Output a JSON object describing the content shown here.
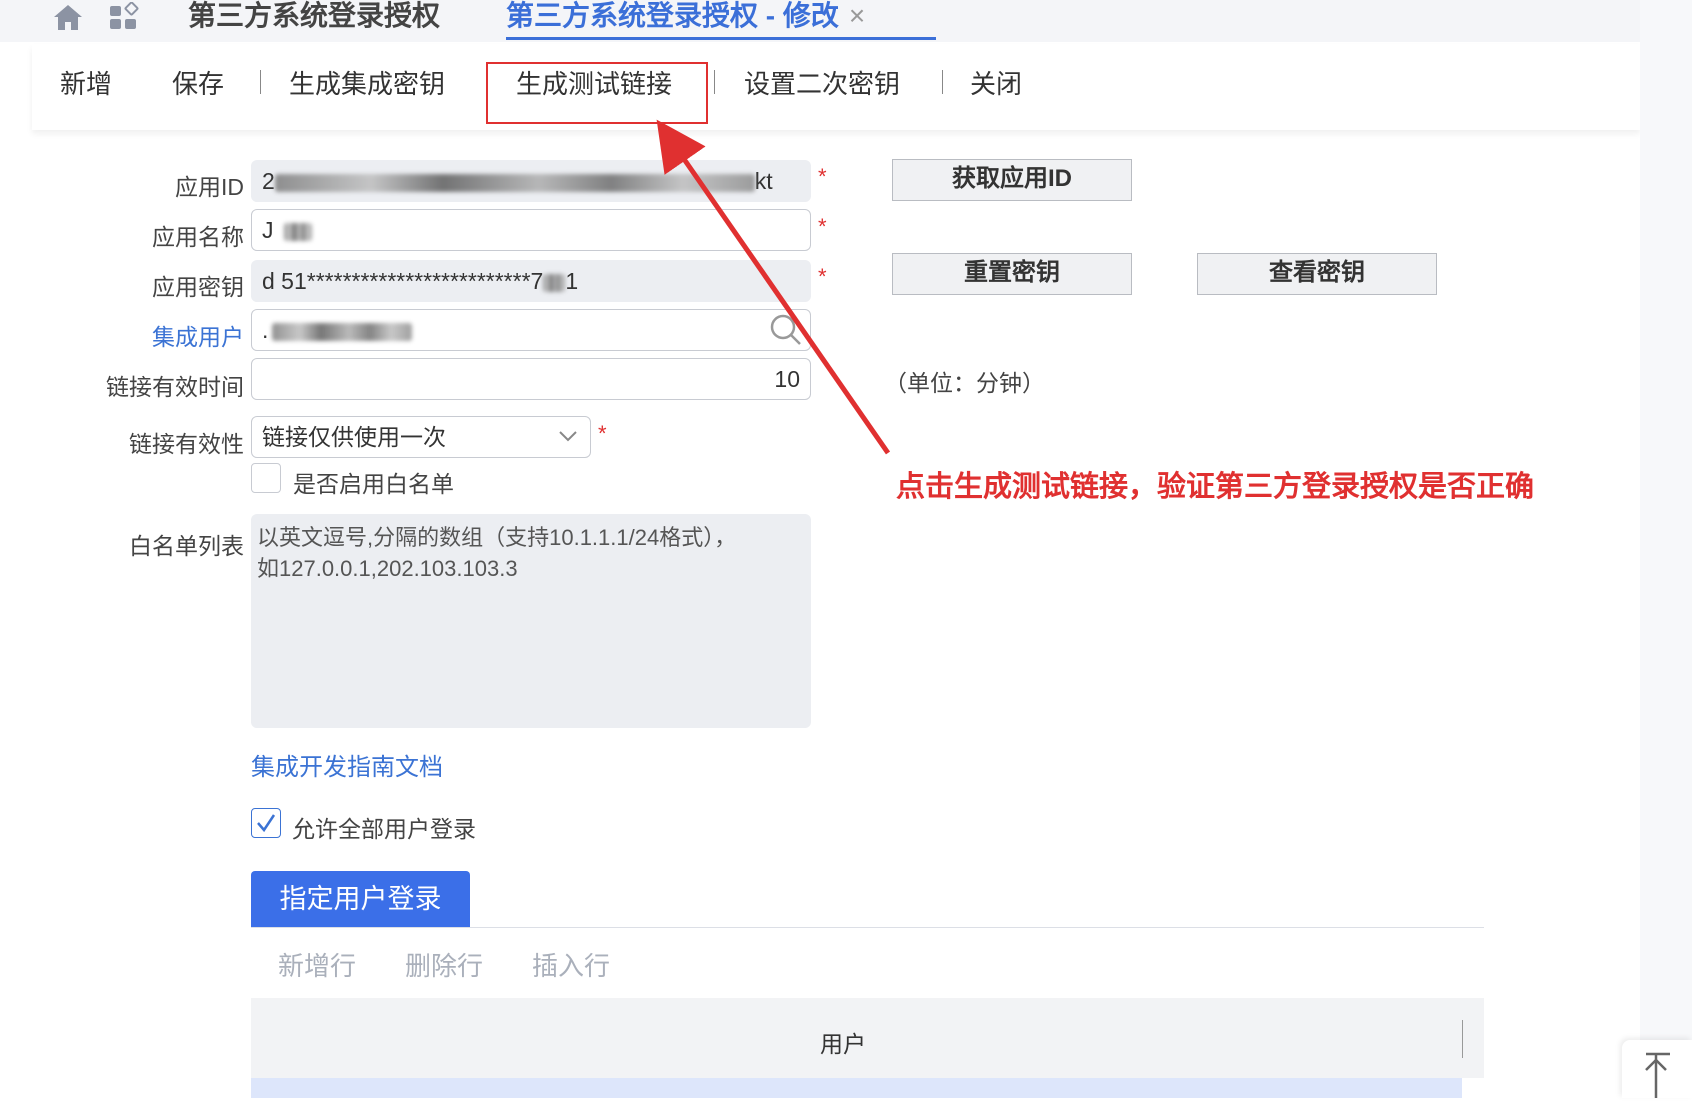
{
  "tabs": {
    "tab1": "第三方系统登录授权",
    "tab2": "第三方系统登录授权 - 修改",
    "close": "×"
  },
  "toolbar": {
    "add": "新增",
    "save": "保存",
    "gen_integration_key": "生成集成密钥",
    "gen_test_link": "生成测试链接",
    "set_secondary_key": "设置二次密钥",
    "close": "关闭"
  },
  "form": {
    "app_id_label": "应用ID",
    "app_id_value_start": "2",
    "app_id_value_end": "kt",
    "app_name_label": "应用名称",
    "app_name_value": "J",
    "app_key_label": "应用密钥",
    "app_key_value": "d 51*************************7",
    "app_key_value_end": "1",
    "integration_user_label": "集成用户",
    "integration_user_value": ".",
    "link_valid_time_label": "链接有效时间",
    "link_valid_time_value": "10",
    "unit_note": "（单位：分钟）",
    "link_validity_label": "链接有效性",
    "link_validity_value": "链接仅供使用一次",
    "enable_whitelist_label": "是否启用白名单",
    "whitelist_label": "白名单列表",
    "whitelist_placeholder_line1": "以英文逗号,分隔的数组（支持10.1.1.1/24格式），",
    "whitelist_placeholder_line2": "如127.0.0.1,202.103.103.3",
    "required_mark": "*"
  },
  "buttons": {
    "get_app_id": "获取应用ID",
    "reset_key": "重置密钥",
    "view_key": "查看密钥"
  },
  "annotation": "点击生成测试链接，验证第三方登录授权是否正确",
  "doc_link": "集成开发指南文档",
  "allow_all_users": "允许全部用户登录",
  "allow_all_checked": true,
  "specified_user_tab": "指定用户登录",
  "sub_toolbar": {
    "add_row": "新增行",
    "delete_row": "删除行",
    "insert_row": "插入行"
  },
  "table": {
    "columns": [
      "用户"
    ]
  },
  "colors": {
    "accent": "#3b6fe8",
    "annotation_red": "#e03030"
  }
}
